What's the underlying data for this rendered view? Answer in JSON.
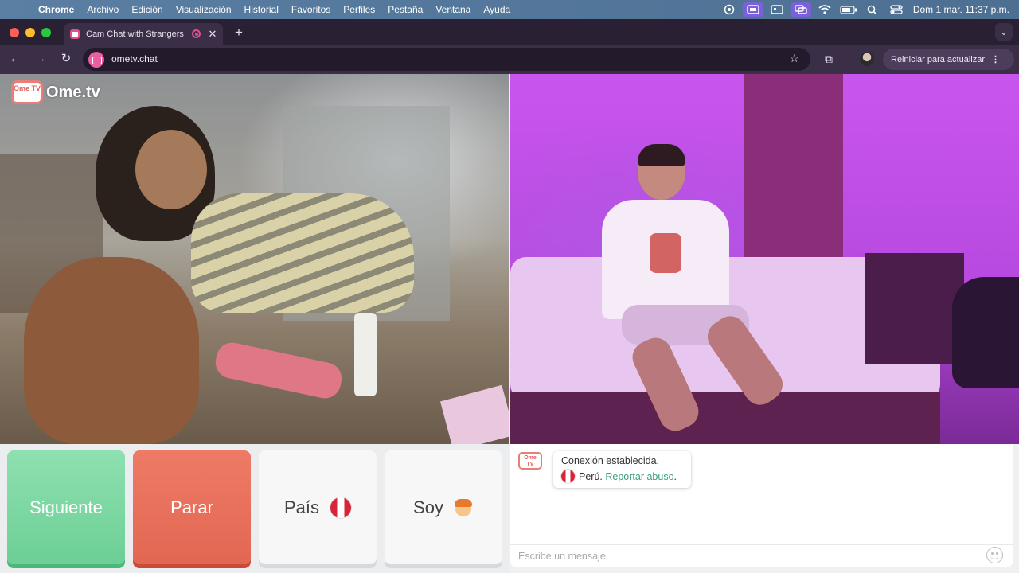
{
  "menubar": {
    "apple": "",
    "items": [
      "Chrome",
      "Archivo",
      "Edición",
      "Visualización",
      "Historial",
      "Favoritos",
      "Perfiles",
      "Pestaña",
      "Ventana",
      "Ayuda"
    ],
    "clock": "Dom 1 mar.  11:37 p.m."
  },
  "browser": {
    "tab_title": "Cam Chat with Strangers",
    "tab_close": "✕",
    "new_tab": "+",
    "tab_menu": "⌄",
    "back": "←",
    "forward": "→",
    "reload": "↻",
    "url": "ometv.chat",
    "bookmark": "☆",
    "extensions": "⧉",
    "restart_label": "Reiniciar para actualizar",
    "restart_menu": "⋮"
  },
  "video": {
    "logo_tv": "Ome TV",
    "logo_word": "Ome.tv"
  },
  "controls": {
    "next_label": "Siguiente",
    "stop_label": "Parar",
    "country_label": "País",
    "me_label": "Soy"
  },
  "chat": {
    "logo": "Ome TV",
    "status": "Conexión establecida.",
    "country": "Perú.",
    "report_link": "Reportar abuso",
    "period": ".",
    "input_placeholder": "Escribe un mensaje"
  },
  "colors": {
    "next": "#6ccf95",
    "stop": "#e26752",
    "link": "#3aa07a",
    "brand": "#e0605c"
  }
}
